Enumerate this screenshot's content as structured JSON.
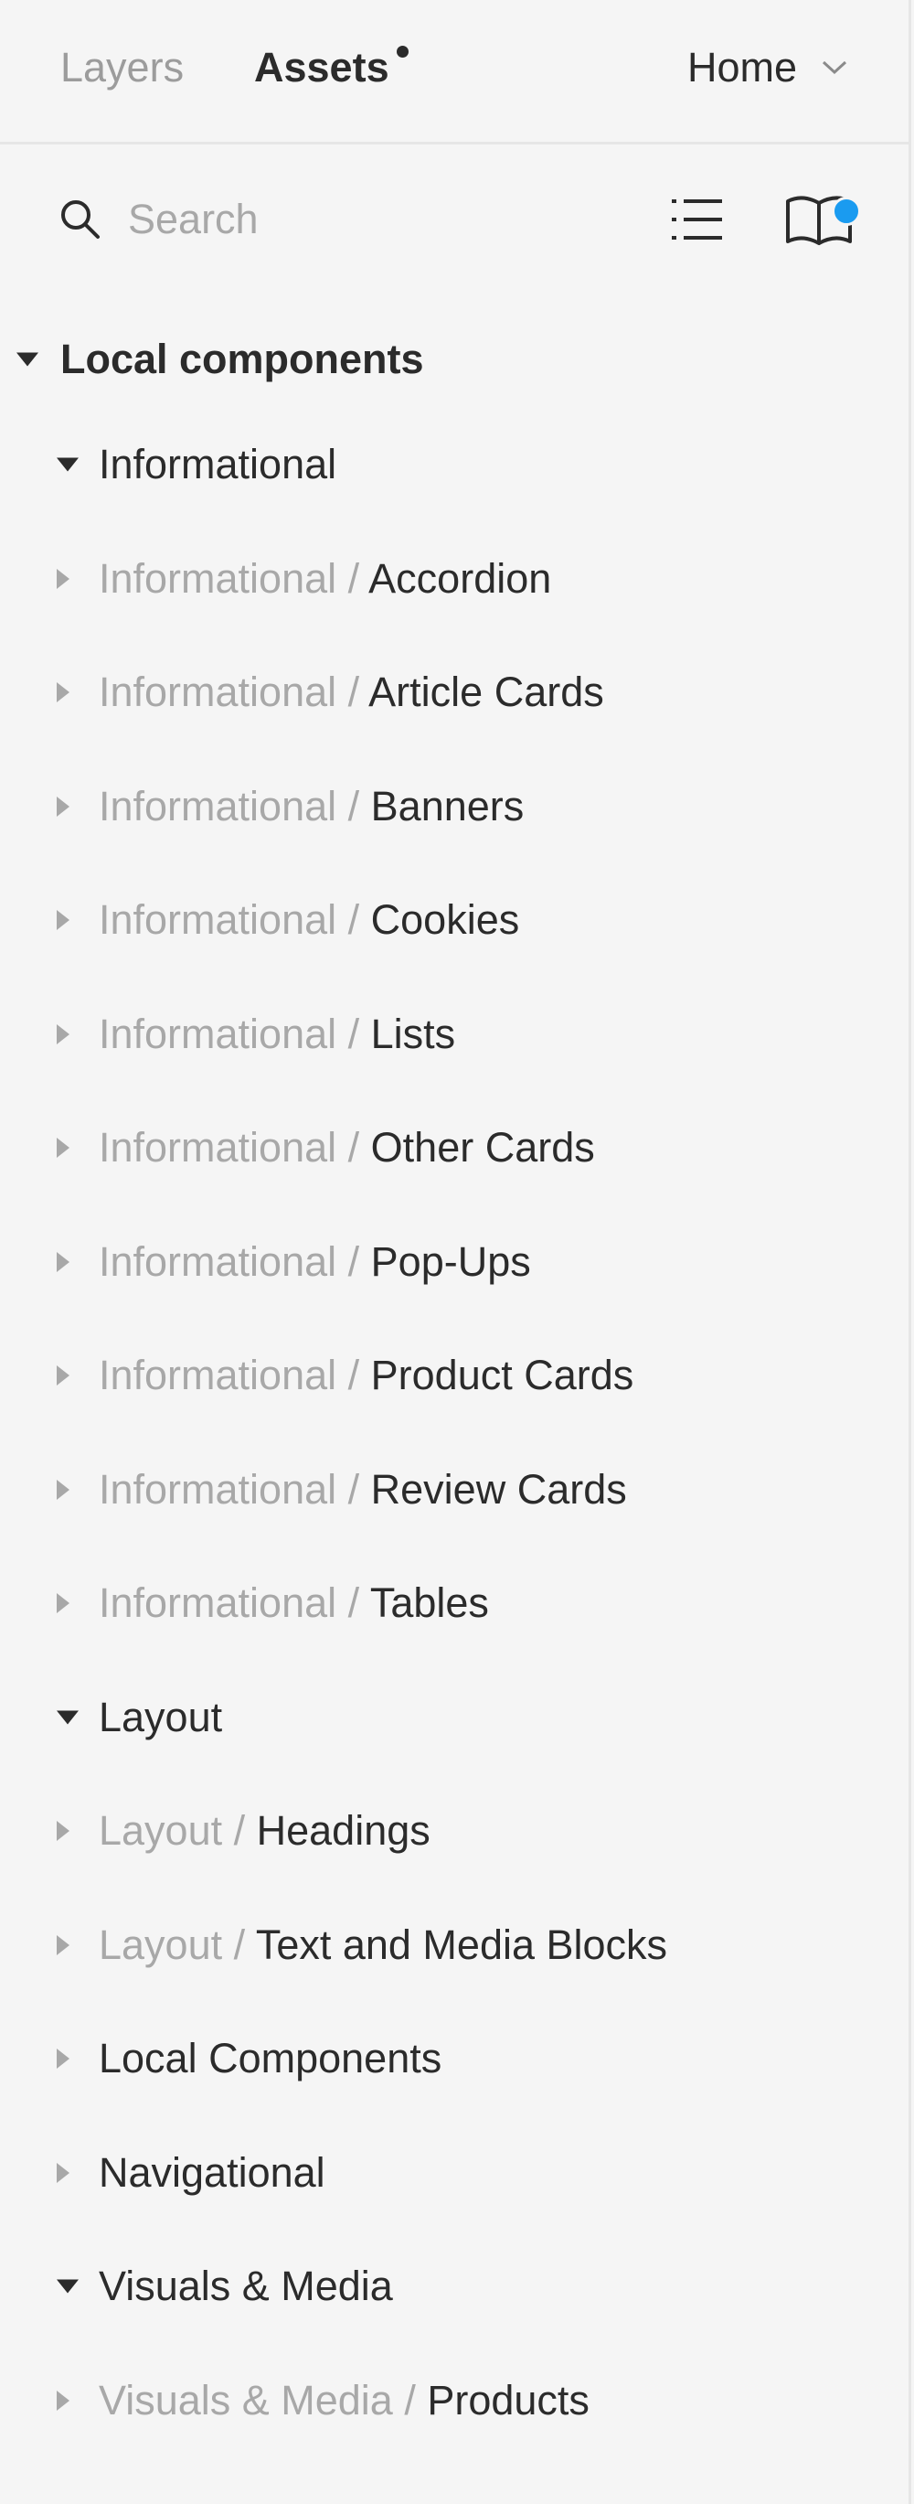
{
  "header": {
    "tabs": [
      {
        "label": "Layers",
        "active": false
      },
      {
        "label": "Assets",
        "active": true
      }
    ],
    "page_select": "Home"
  },
  "search": {
    "placeholder": "Search"
  },
  "colors": {
    "accent_dot": "#1a9bf0",
    "text": "#2b2b2b",
    "muted": "#a8a8a8"
  },
  "tree": {
    "section_label": "Local components",
    "rows": [
      {
        "kind": "group",
        "expanded": true,
        "prefix": "",
        "name": "Informational"
      },
      {
        "kind": "item",
        "expanded": false,
        "prefix": "Informational / ",
        "name": "Accordion"
      },
      {
        "kind": "item",
        "expanded": false,
        "prefix": "Informational / ",
        "name": "Article Cards"
      },
      {
        "kind": "item",
        "expanded": false,
        "prefix": "Informational / ",
        "name": "Banners"
      },
      {
        "kind": "item",
        "expanded": false,
        "prefix": "Informational / ",
        "name": "Cookies"
      },
      {
        "kind": "item",
        "expanded": false,
        "prefix": "Informational / ",
        "name": "Lists"
      },
      {
        "kind": "item",
        "expanded": false,
        "prefix": "Informational / ",
        "name": "Other Cards"
      },
      {
        "kind": "item",
        "expanded": false,
        "prefix": "Informational / ",
        "name": "Pop-Ups"
      },
      {
        "kind": "item",
        "expanded": false,
        "prefix": "Informational / ",
        "name": "Product Cards"
      },
      {
        "kind": "item",
        "expanded": false,
        "prefix": "Informational / ",
        "name": "Review Cards"
      },
      {
        "kind": "item",
        "expanded": false,
        "prefix": "Informational / ",
        "name": "Tables"
      },
      {
        "kind": "group",
        "expanded": true,
        "prefix": "",
        "name": "Layout"
      },
      {
        "kind": "item",
        "expanded": false,
        "prefix": "Layout / ",
        "name": "Headings"
      },
      {
        "kind": "item",
        "expanded": false,
        "prefix": "Layout / ",
        "name": "Text and Media Blocks"
      },
      {
        "kind": "group",
        "expanded": false,
        "prefix": "",
        "name": "Local Components"
      },
      {
        "kind": "group",
        "expanded": false,
        "prefix": "",
        "name": "Navigational"
      },
      {
        "kind": "group",
        "expanded": true,
        "prefix": "",
        "name": "Visuals & Media"
      },
      {
        "kind": "item",
        "expanded": false,
        "prefix": "Visuals & Media / ",
        "name": "Products"
      }
    ]
  }
}
